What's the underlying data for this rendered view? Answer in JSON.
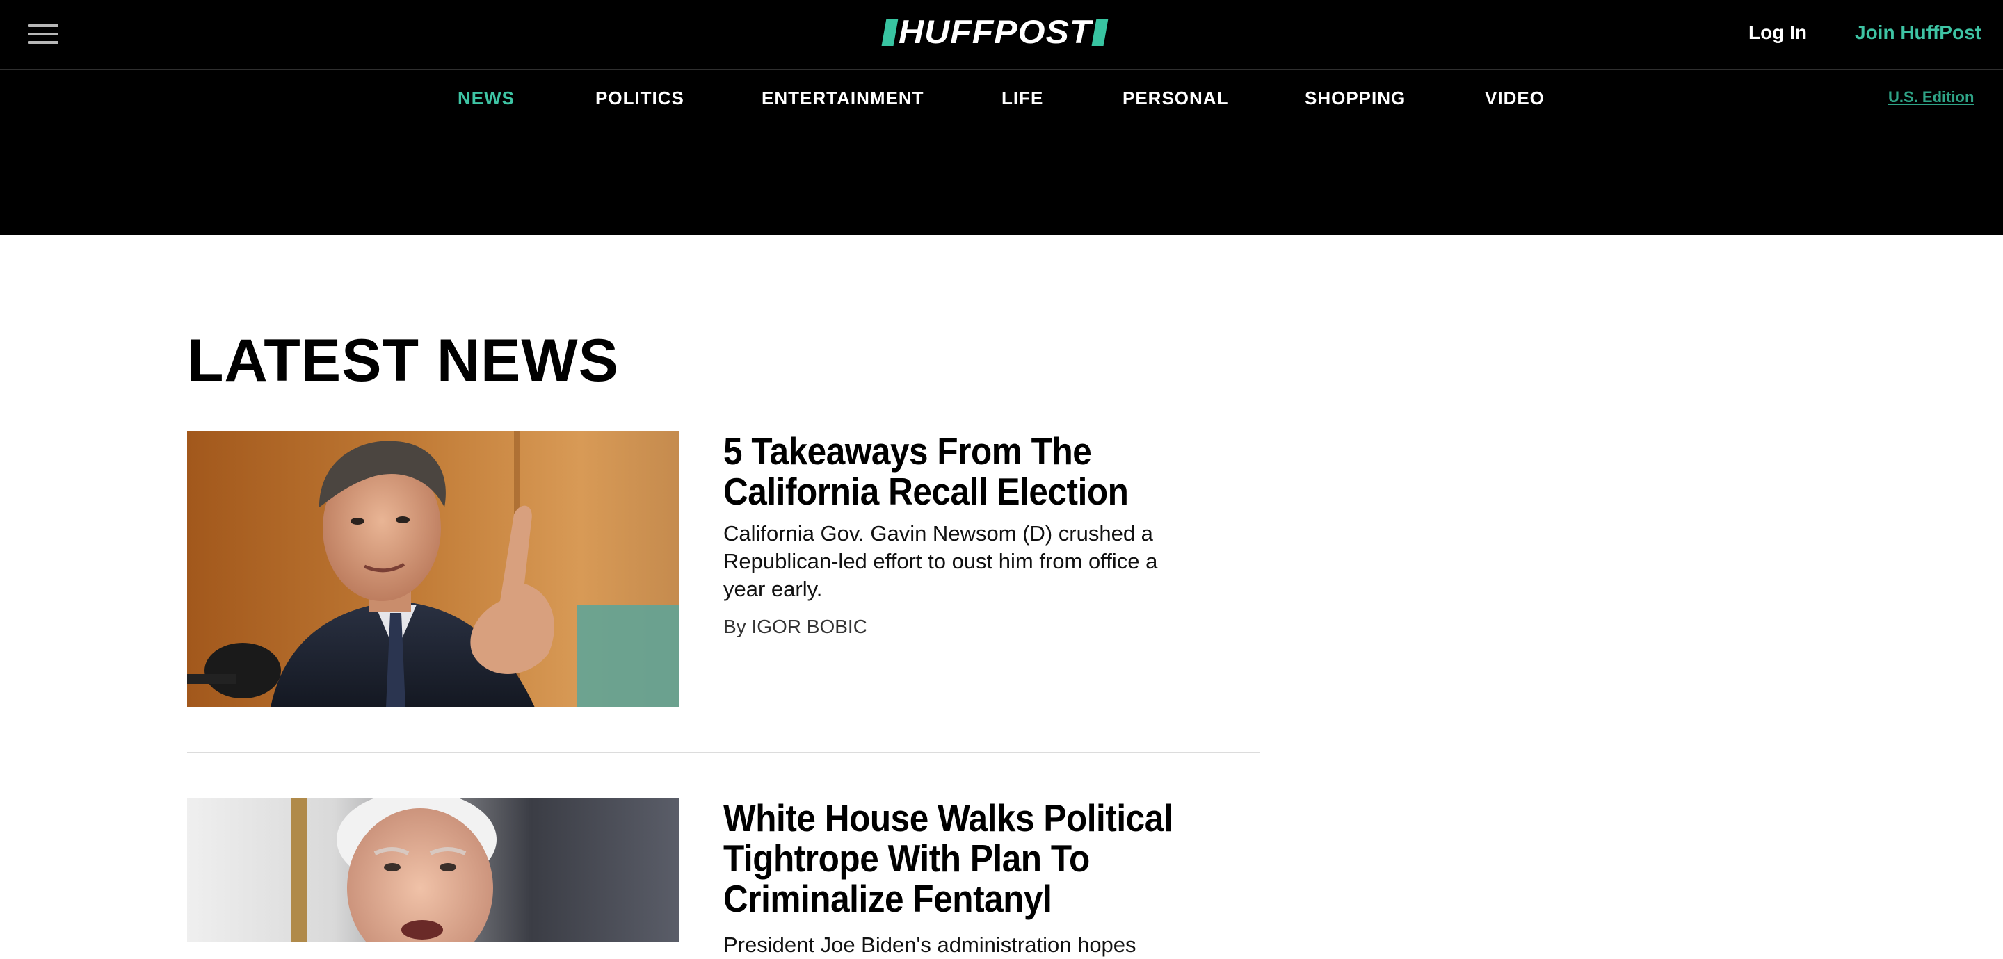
{
  "header": {
    "logo_text": "HUFFPOST",
    "login_label": "Log In",
    "join_label": "Join HuffPost",
    "edition_label": "U.S. Edition",
    "accent_color": "#3ec4a4"
  },
  "nav": {
    "items": [
      {
        "label": "NEWS",
        "active": true
      },
      {
        "label": "POLITICS",
        "active": false
      },
      {
        "label": "ENTERTAINMENT",
        "active": false
      },
      {
        "label": "LIFE",
        "active": false
      },
      {
        "label": "PERSONAL",
        "active": false
      },
      {
        "label": "SHOPPING",
        "active": false
      },
      {
        "label": "VIDEO",
        "active": false
      }
    ]
  },
  "main": {
    "section_title": "LATEST NEWS",
    "articles": [
      {
        "headline": "5 Takeaways From The California Recall Election",
        "summary": "California Gov. Gavin Newsom (D) crushed a Republican-led effort to oust him from office a year early.",
        "byline": "By IGOR BOBIC",
        "image": "photo-man-pointing-finger"
      },
      {
        "headline": "White House Walks Political Tightrope With Plan To Criminalize Fentanyl",
        "summary": "President Joe Biden's administration hopes",
        "image": "photo-older-man-speaking"
      }
    ]
  }
}
